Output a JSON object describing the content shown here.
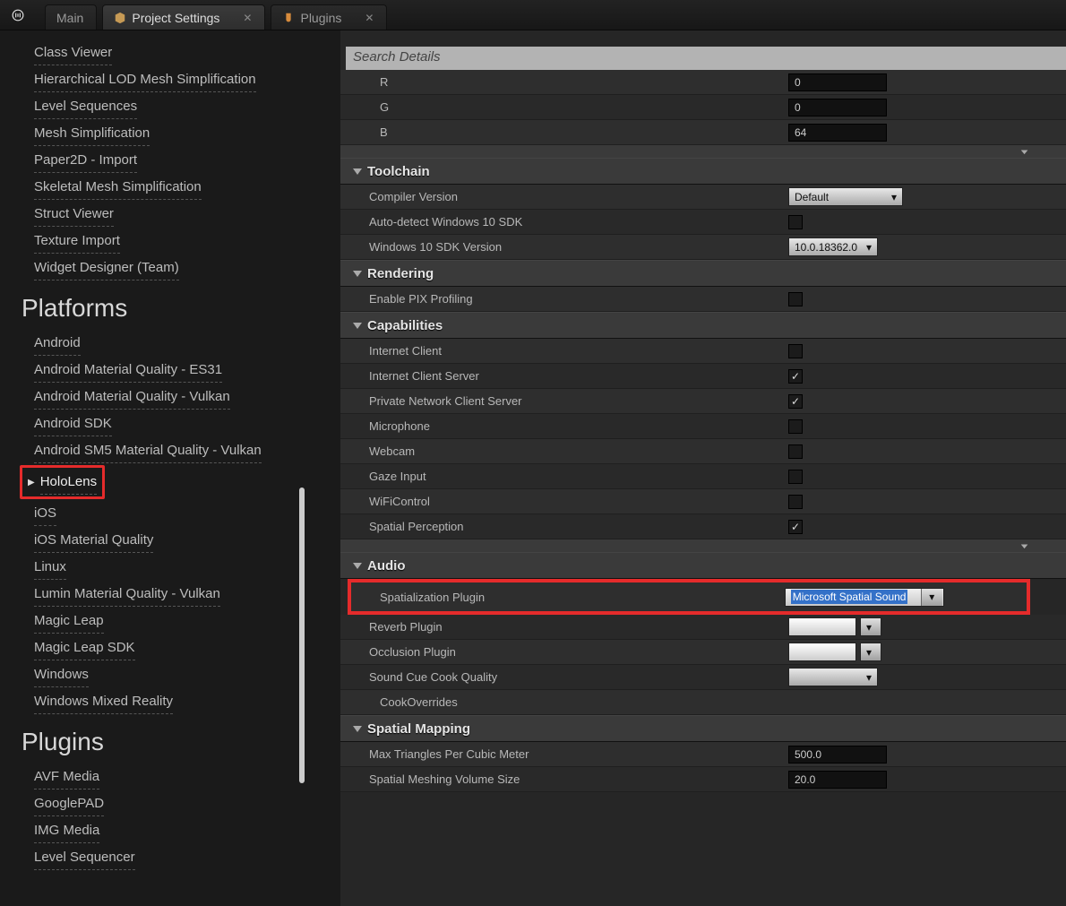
{
  "tabs": {
    "main": "Main",
    "active": "Project Settings",
    "plugins": "Plugins"
  },
  "sidebar": {
    "editor": {
      "items": [
        "Class Viewer",
        "Hierarchical LOD Mesh Simplification",
        "Level Sequences",
        "Mesh Simplification",
        "Paper2D - Import",
        "Skeletal Mesh Simplification",
        "Struct Viewer",
        "Texture Import",
        "Widget Designer (Team)"
      ]
    },
    "platforms": {
      "header": "Platforms",
      "items": [
        "Android",
        "Android Material Quality - ES31",
        "Android Material Quality - Vulkan",
        "Android SDK",
        "Android SM5 Material Quality - Vulkan",
        "HoloLens",
        "iOS",
        "iOS Material Quality",
        "Linux",
        "Lumin Material Quality - Vulkan",
        "Magic Leap",
        "Magic Leap SDK",
        "Windows",
        "Windows Mixed Reality"
      ]
    },
    "plugins": {
      "header": "Plugins",
      "items": [
        "AVF Media",
        "GooglePAD",
        "IMG Media",
        "Level Sequencer"
      ]
    }
  },
  "panel": {
    "searchPlaceholder": "Search Details",
    "rgb": {
      "r_label": "R",
      "g_label": "G",
      "b_label": "B",
      "r": "0",
      "g": "0",
      "b": "64"
    },
    "toolchain": {
      "header": "Toolchain",
      "compiler_label": "Compiler Version",
      "compiler_val": "Default",
      "autodetect_label": "Auto-detect Windows 10 SDK",
      "sdkver_label": "Windows 10 SDK Version",
      "sdkver_val": "10.0.18362.0"
    },
    "rendering": {
      "header": "Rendering",
      "pix_label": "Enable PIX Profiling"
    },
    "capabilities": {
      "header": "Capabilities",
      "items": [
        {
          "label": "Internet Client",
          "checked": false
        },
        {
          "label": "Internet Client Server",
          "checked": true
        },
        {
          "label": "Private Network Client Server",
          "checked": true
        },
        {
          "label": "Microphone",
          "checked": false
        },
        {
          "label": "Webcam",
          "checked": false
        },
        {
          "label": "Gaze Input",
          "checked": false
        },
        {
          "label": "WiFiControl",
          "checked": false
        },
        {
          "label": "Spatial Perception",
          "checked": true
        }
      ]
    },
    "audio": {
      "header": "Audio",
      "spat_label": "Spatialization Plugin",
      "spat_val": "Microsoft Spatial Sound",
      "reverb_label": "Reverb Plugin",
      "occlusion_label": "Occlusion Plugin",
      "cue_label": "Sound Cue Cook Quality",
      "cook_label": "CookOverrides"
    },
    "spatial": {
      "header": "Spatial Mapping",
      "max_label": "Max Triangles Per Cubic Meter",
      "max_val": "500.0",
      "vol_label": "Spatial Meshing Volume Size",
      "vol_val": "20.0"
    }
  }
}
